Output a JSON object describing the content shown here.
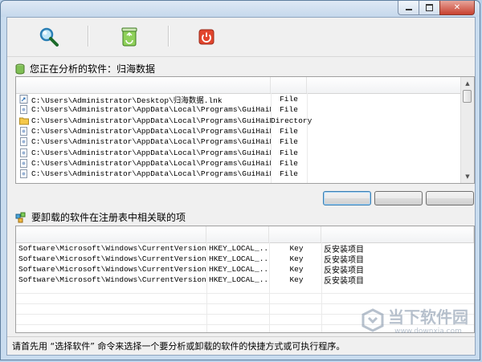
{
  "window": {
    "minimize_icon": "minimize-icon",
    "maximize_icon": "maximize-icon",
    "close_glyph": "✕"
  },
  "toolbar": {
    "buttons": [
      {
        "icon": "magnifier-icon"
      },
      {
        "icon": "recycle-bin-icon"
      },
      {
        "icon": "power-icon"
      }
    ]
  },
  "analysis": {
    "label": "您正在分析的软件：归海数据",
    "rows": [
      {
        "path": "C:\\Users\\Administrator\\Desktop\\归海数据.lnk",
        "type": "File"
      },
      {
        "path": "C:\\Users\\Administrator\\AppData\\Local\\Programs\\GuiHaiData\\...",
        "type": "File"
      },
      {
        "path": "C:\\Users\\Administrator\\AppData\\Local\\Programs\\GuiHaiData",
        "type": "Directory"
      },
      {
        "path": "C:\\Users\\Administrator\\AppData\\Local\\Programs\\GuiHaiData\\d...",
        "type": "File"
      },
      {
        "path": "C:\\Users\\Administrator\\AppData\\Local\\Programs\\GuiHaiData\\f...",
        "type": "File"
      },
      {
        "path": "C:\\Users\\Administrator\\AppData\\Local\\Programs\\GuiHaiData\\l...",
        "type": "File"
      },
      {
        "path": "C:\\Users\\Administrator\\AppData\\Local\\Programs\\GuiHaiData\\l...",
        "type": "File"
      },
      {
        "path": "C:\\Users\\Administrator\\AppData\\Local\\Programs\\GuiHaiData\\...",
        "type": "File"
      }
    ]
  },
  "registry": {
    "label": "要卸载的软件在注册表中相关联的项",
    "rows": [
      {
        "key": "Software\\Microsoft\\Windows\\CurrentVersion\\Uni...",
        "hive": "HKEY_LOCAL_...",
        "kind": "Key",
        "desc": "反安装项目"
      },
      {
        "key": "Software\\Microsoft\\Windows\\CurrentVersion\\Uni...",
        "hive": "HKEY_LOCAL_...",
        "kind": "Key",
        "desc": "反安装项目"
      },
      {
        "key": "Software\\Microsoft\\Windows\\CurrentVersion\\Uni...",
        "hive": "HKEY_LOCAL_...",
        "kind": "Key",
        "desc": "反安装项目"
      },
      {
        "key": "Software\\Microsoft\\Windows\\CurrentVersion\\Uni...",
        "hive": "HKEY_LOCAL_...",
        "kind": "Key",
        "desc": "反安装项目"
      }
    ]
  },
  "status": {
    "text": "请首先用 “选择软件” 命令来选择一个要分析或卸载的软件的快捷方式或可执行程序。"
  },
  "watermark": {
    "name": "当下软件园",
    "url": "www.downxia.com"
  },
  "colors": {
    "accent": "#3c7fb1",
    "close": "#c7402f"
  }
}
